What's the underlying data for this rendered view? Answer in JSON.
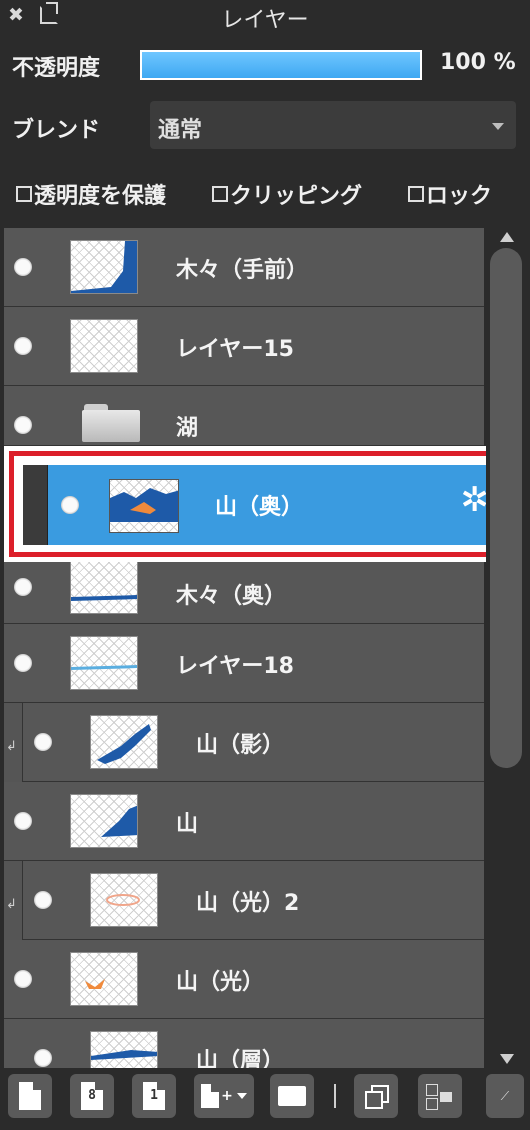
{
  "panel": {
    "title": "レイヤー"
  },
  "opacity": {
    "label": "不透明度",
    "value_text": "100 %",
    "value": 100
  },
  "blend": {
    "label": "ブレンド",
    "value": "通常"
  },
  "options": {
    "protect_alpha": "透明度を保護",
    "clipping": "クリッピング",
    "lock": "ロック"
  },
  "layers": [
    {
      "name": "木々（手前）",
      "type": "layer",
      "clipped": false
    },
    {
      "name": "レイヤー15",
      "type": "layer",
      "clipped": false
    },
    {
      "name": "湖",
      "type": "folder",
      "clipped": false
    },
    {
      "name": "山（奥）",
      "type": "layer",
      "clipped": false,
      "selected": true
    },
    {
      "name": "木々（奥）",
      "type": "layer",
      "clipped": false
    },
    {
      "name": "レイヤー18",
      "type": "layer",
      "clipped": false
    },
    {
      "name": "山（影）",
      "type": "layer",
      "clipped": true
    },
    {
      "name": "山",
      "type": "layer",
      "clipped": false
    },
    {
      "name": "山（光）2",
      "type": "layer",
      "clipped": true
    },
    {
      "name": "山（光）",
      "type": "layer",
      "clipped": false
    },
    {
      "name": "山（層）",
      "type": "layer",
      "clipped": false
    }
  ],
  "toolbar": {
    "icons": [
      "new-layer",
      "new-8bit-layer",
      "new-1bit-layer",
      "add-layer-menu",
      "new-folder",
      "duplicate-layer",
      "merge-layer",
      "more"
    ],
    "labels": {
      "eight": "8",
      "one": "1"
    }
  },
  "colors": {
    "accent": "#3a9be0",
    "highlight": "#dc1f2a",
    "panel_bg": "#2b2b2b",
    "row_bg": "#575757"
  }
}
